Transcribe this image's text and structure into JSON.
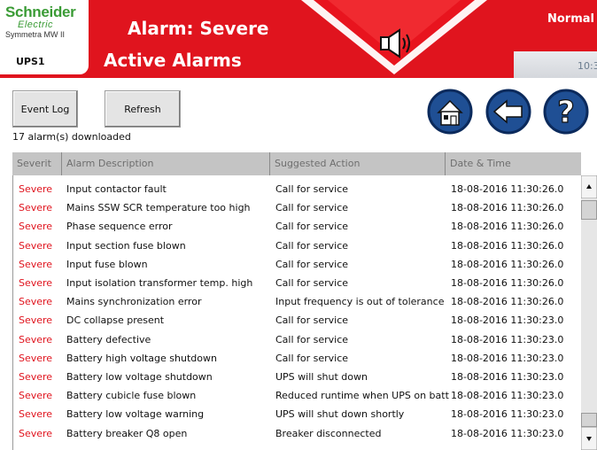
{
  "header": {
    "brand_line1": "Schneider",
    "brand_line2": "Electric",
    "product": "Symmetra MW II",
    "device": "UPS1",
    "alarm_title": "Alarm: Severe",
    "page_title": "Active Alarms",
    "status": "Normal",
    "clock": "10:3",
    "colors": {
      "header": "#e0141e",
      "brand": "#3a9b35"
    }
  },
  "toolbar": {
    "event_log_label": "Event Log",
    "refresh_label": "Refresh",
    "downloaded_text": "17 alarm(s) downloaded",
    "icons": [
      "home-icon",
      "back-arrow-icon",
      "help-icon"
    ]
  },
  "table": {
    "columns": [
      "Severit",
      "Alarm Description",
      "Suggested Action",
      "Date & Time"
    ],
    "rows": [
      {
        "severity": "Severe",
        "description": "Input contactor fault",
        "action": "Call for service",
        "datetime": "18-08-2016 11:30:26.0"
      },
      {
        "severity": "Severe",
        "description": "Mains SSW SCR temperature too high",
        "action": "Call for service",
        "datetime": "18-08-2016 11:30:26.0"
      },
      {
        "severity": "Severe",
        "description": "Phase sequence error",
        "action": "Call for service",
        "datetime": "18-08-2016 11:30:26.0"
      },
      {
        "severity": "Severe",
        "description": "Input section fuse blown",
        "action": "Call for service",
        "datetime": "18-08-2016 11:30:26.0"
      },
      {
        "severity": "Severe",
        "description": "Input fuse blown",
        "action": "Call for service",
        "datetime": "18-08-2016 11:30:26.0"
      },
      {
        "severity": "Severe",
        "description": "Input isolation transformer temp. high",
        "action": "Call for service",
        "datetime": "18-08-2016 11:30:26.0"
      },
      {
        "severity": "Severe",
        "description": "Mains synchronization error",
        "action": "Input frequency is out of tolerance",
        "datetime": "18-08-2016 11:30:26.0"
      },
      {
        "severity": "Severe",
        "description": "DC collapse present",
        "action": "Call for service",
        "datetime": "18-08-2016 11:30:23.0"
      },
      {
        "severity": "Severe",
        "description": "Battery defective",
        "action": "Call for service",
        "datetime": "18-08-2016 11:30:23.0"
      },
      {
        "severity": "Severe",
        "description": "Battery high voltage shutdown",
        "action": "Call for service",
        "datetime": "18-08-2016 11:30:23.0"
      },
      {
        "severity": "Severe",
        "description": "Battery low voltage shutdown",
        "action": "UPS will shut down",
        "datetime": "18-08-2016 11:30:23.0"
      },
      {
        "severity": "Severe",
        "description": "Battery cubicle fuse blown",
        "action": "Reduced runtime when UPS on batt",
        "datetime": "18-08-2016 11:30:23.0"
      },
      {
        "severity": "Severe",
        "description": "Battery low voltage warning",
        "action": "UPS will shut down shortly",
        "datetime": "18-08-2016 11:30:23.0"
      },
      {
        "severity": "Severe",
        "description": "Battery breaker Q8 open",
        "action": "Breaker disconnected",
        "datetime": "18-08-2016 11:30:23.0"
      }
    ]
  }
}
